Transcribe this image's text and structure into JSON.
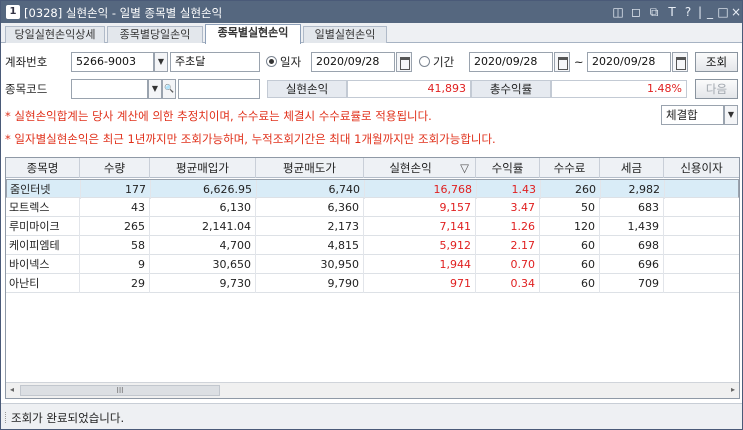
{
  "window": {
    "number": "1",
    "title": "[0328] 실현손익 - 일별 종목별 실현손익",
    "controls": [
      "◫",
      "◻",
      "⧉",
      "T",
      "?",
      "|",
      "_",
      "□",
      "×"
    ]
  },
  "tabs": [
    {
      "label": "당일실현손익상세"
    },
    {
      "label": "종목별당일손익"
    },
    {
      "label": "종목별실현손익"
    },
    {
      "label": "일별실현손익"
    }
  ],
  "form": {
    "account_label": "계좌번호",
    "account_value": "5266-9003",
    "account_name": "주초달",
    "mode_daily_label": "일자",
    "date_single": "2020/09/28",
    "mode_period_label": "기간",
    "date_from": "2020/09/28",
    "date_sep": "~",
    "date_to": "2020/09/28",
    "query_button": "조회",
    "code_label": "종목코드",
    "code_value": "",
    "code_name": "",
    "realized_label": "실현손익",
    "realized_value": "41,893",
    "return_label": "총수익률",
    "return_value": "1.48%",
    "next_button": "다음",
    "filter_value": "체결합"
  },
  "notes": [
    "* 실현손익합계는 당사 계산에 의한 추정치이며, 수수료는 체결시 수수료률로 적용됩니다.",
    "* 일자별실현손익은 최근 1년까지만 조회가능하며, 누적조회기간은 최대 1개월까지만 조회가능합니다."
  ],
  "table": {
    "headers": [
      "종목명",
      "수량",
      "평균매입가",
      "평균매도가",
      "실현손익",
      "▽",
      "수익률",
      "수수료",
      "세금",
      "신용이자"
    ],
    "rows": [
      {
        "name": "줌인터넷",
        "qty": "177",
        "buy": "6,626.95",
        "sell": "6,740",
        "pnl": "16,768",
        "rate": "1.43",
        "fee": "260",
        "tax": "2,982",
        "credit": ""
      },
      {
        "name": "모트렉스",
        "qty": "43",
        "buy": "6,130",
        "sell": "6,360",
        "pnl": "9,157",
        "rate": "3.47",
        "fee": "50",
        "tax": "683",
        "credit": ""
      },
      {
        "name": "루미마이크",
        "qty": "265",
        "buy": "2,141.04",
        "sell": "2,173",
        "pnl": "7,141",
        "rate": "1.26",
        "fee": "120",
        "tax": "1,439",
        "credit": ""
      },
      {
        "name": "케이피엠테",
        "qty": "58",
        "buy": "4,700",
        "sell": "4,815",
        "pnl": "5,912",
        "rate": "2.17",
        "fee": "60",
        "tax": "698",
        "credit": ""
      },
      {
        "name": "바이넥스",
        "qty": "9",
        "buy": "30,650",
        "sell": "30,950",
        "pnl": "1,944",
        "rate": "0.70",
        "fee": "60",
        "tax": "696",
        "credit": ""
      },
      {
        "name": "아난티",
        "qty": "29",
        "buy": "9,730",
        "sell": "9,790",
        "pnl": "971",
        "rate": "0.34",
        "fee": "60",
        "tax": "709",
        "credit": ""
      }
    ],
    "scroll_left": "◂",
    "scroll_right": "▸",
    "scroll_grip": "III"
  },
  "status": {
    "text": "조회가 완료되었습니다."
  },
  "colors": {
    "title_bar": "#55677f",
    "note_red": "#e0301a",
    "value_red": "#e02020",
    "selected_row": "#d9ecf7"
  }
}
